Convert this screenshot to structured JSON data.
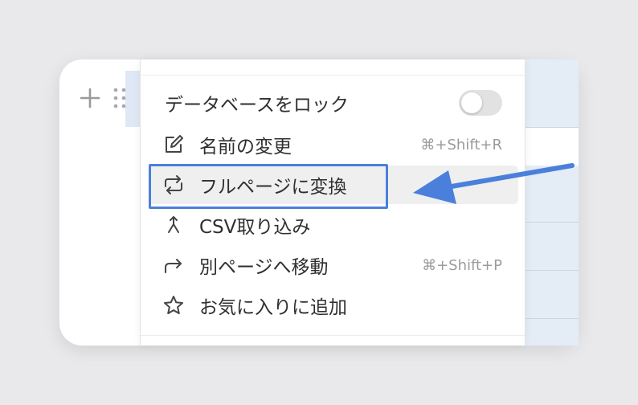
{
  "menu": {
    "items": [
      {
        "label": "データベースをロック",
        "control": "toggle",
        "toggle_on": false
      },
      {
        "label": "名前の変更",
        "icon": "edit-icon",
        "shortcut": "⌘+Shift+R"
      },
      {
        "label": "フルページに変換",
        "icon": "convert-icon",
        "highlighted": true
      },
      {
        "label": "CSV取り込み",
        "icon": "merge-icon"
      },
      {
        "label": "別ページへ移動",
        "icon": "move-arrow-icon",
        "shortcut": "⌘+Shift+P"
      },
      {
        "label": "お気に入りに追加",
        "icon": "star-icon"
      }
    ]
  },
  "colors": {
    "callout": "#4a80db",
    "highlight_bg": "#efefef",
    "text": "#2f2f2f",
    "shortcut": "#9b9b9b"
  }
}
